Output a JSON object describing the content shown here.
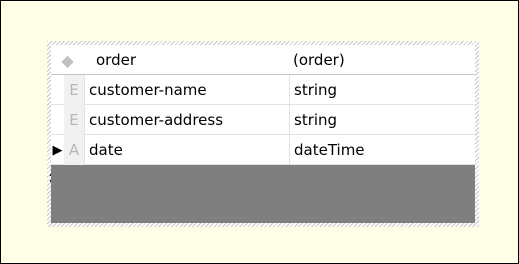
{
  "schema": {
    "header": {
      "icon": "diamond-icon",
      "name": "order",
      "type": "(order)"
    },
    "rows": [
      {
        "kind": "E",
        "name": "customer-name",
        "type": "string"
      },
      {
        "kind": "E",
        "name": "customer-address",
        "type": "string"
      },
      {
        "kind": "A",
        "name": "date",
        "type": "dateTime",
        "selected_marker": "▶"
      }
    ],
    "new_row_marker": "✱"
  }
}
